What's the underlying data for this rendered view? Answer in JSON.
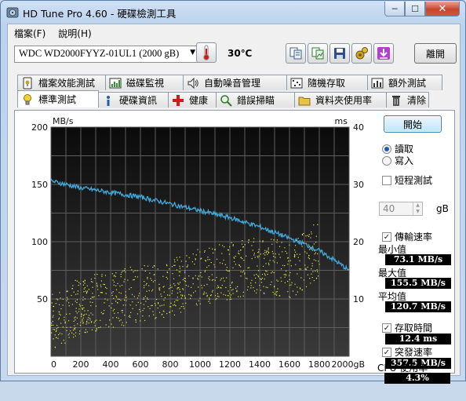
{
  "window": {
    "title": "HD Tune Pro 4.60 - 硬碟檢測工具",
    "controls": {
      "minimize": "─",
      "maximize": "☐",
      "close": "✕"
    }
  },
  "menu": [
    {
      "label": "檔案(F)"
    },
    {
      "label": "說明(H)"
    }
  ],
  "toolbar": {
    "drive": "WDC     WD2000FYYZ-01UL1 (2000 gB)",
    "temperature": "30℃",
    "exit_label": "離開",
    "icons": [
      "copy-info-icon",
      "copy-screenshot-icon",
      "save-icon",
      "options-icon",
      "download-icon"
    ]
  },
  "tabs_top": [
    {
      "label": "檔案效能測試",
      "icon": "file-benchmark-icon"
    },
    {
      "label": "磁碟監視",
      "icon": "disk-monitor-icon"
    },
    {
      "label": "自動噪音管理",
      "icon": "speaker-icon"
    },
    {
      "label": "隨機存取",
      "icon": "random-access-icon"
    },
    {
      "label": "額外測試",
      "icon": "extra-tests-icon"
    }
  ],
  "tabs_bottom": [
    {
      "label": "標準測試",
      "icon": "lightbulb-icon",
      "active": true
    },
    {
      "label": "硬碟資訊",
      "icon": "info-icon"
    },
    {
      "label": "健康",
      "icon": "health-cross-icon"
    },
    {
      "label": "錯誤掃瞄",
      "icon": "error-scan-icon"
    },
    {
      "label": "資料夾使用率",
      "icon": "folder-icon"
    },
    {
      "label": "清除",
      "icon": "erase-trash-icon"
    }
  ],
  "side": {
    "start_label": "開始",
    "read_label": "讀取",
    "write_label": "寫入",
    "mode_selected": "read",
    "short_test_label": "短程測試",
    "short_test_checked": false,
    "short_test_value": "40",
    "short_test_unit": "gB",
    "transfer_label": "傳輸速率",
    "transfer_checked": true,
    "min_label": "最小值",
    "min_value": "73.1 MB/s",
    "max_label": "最大值",
    "max_value": "155.5 MB/s",
    "avg_label": "平均值",
    "avg_value": "120.7 MB/s",
    "access_label": "存取時間",
    "access_checked": true,
    "access_value": "12.4 ms",
    "burst_label": "突發速率",
    "burst_checked": true,
    "burst_value": "357.5 MB/s",
    "cpu_label": "CPU 使用率",
    "cpu_value": "4.3%"
  },
  "chart_data": {
    "type": "line",
    "left_unit": "MB/s",
    "right_unit": "ms",
    "ylim_left": [
      0,
      200
    ],
    "ylim_right": [
      0,
      40
    ],
    "xlim": [
      0,
      2000
    ],
    "x_unit": "gB",
    "x_ticks": [
      "0",
      "200",
      "400",
      "600",
      "800",
      "1000",
      "1200",
      "1400",
      "1600",
      "1800",
      "2000gB"
    ],
    "y_ticks_left": [
      "50",
      "100",
      "150",
      "200"
    ],
    "y_ticks_right": [
      "10",
      "20",
      "30",
      "40"
    ],
    "grid": true,
    "series": [
      {
        "axis": "left",
        "color": "#3fa9dc",
        "x": [
          0,
          100,
          200,
          300,
          400,
          500,
          600,
          700,
          800,
          900,
          1000,
          1100,
          1200,
          1300,
          1400,
          1500,
          1600,
          1700,
          1800,
          1900,
          2000
        ],
        "values": [
          153,
          150,
          147,
          145,
          143,
          141,
          139,
          136,
          133,
          130,
          127,
          124,
          121,
          117,
          113,
          108,
          103,
          98,
          92,
          84,
          75
        ]
      },
      {
        "axis": "right",
        "color": "#e5e54a",
        "type": "scatter",
        "x": [
          0,
          200,
          400,
          600,
          800,
          1000,
          1200,
          1400,
          1600,
          1800
        ],
        "values": [
          6,
          9,
          10,
          11,
          12,
          14,
          15,
          16,
          15,
          19
        ],
        "spread": 5
      }
    ]
  }
}
